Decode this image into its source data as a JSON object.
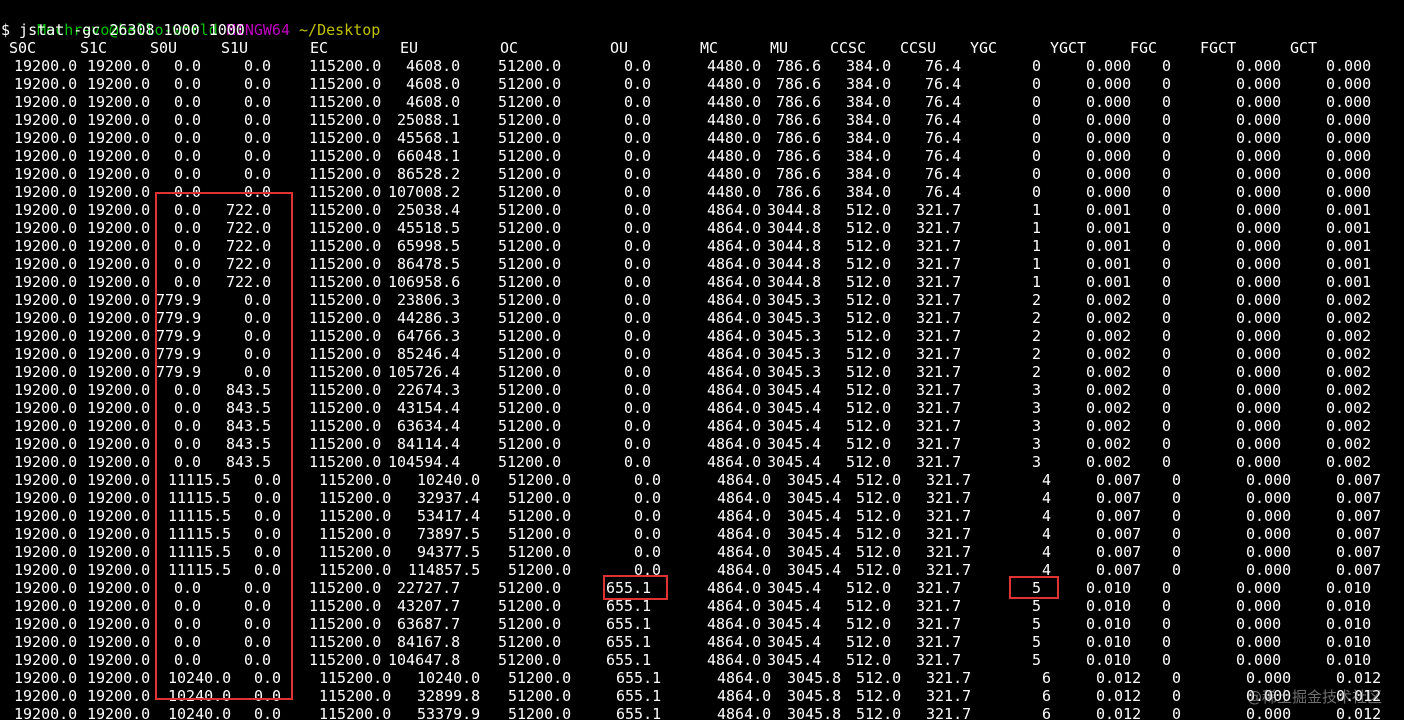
{
  "prompt": {
    "user_host": "Mechrevo@hello-world",
    "shell": "MINGW64",
    "cwd": "~/Desktop"
  },
  "command": "$ jstat -gc 26308 1000 1000",
  "columns": [
    "S0C",
    "S1C",
    "S0U",
    "S1U",
    "EC",
    "EU",
    "OC",
    "OU",
    "MC",
    "MU",
    "CCSC",
    "CCSU",
    "YGC",
    "YGCT",
    "FGC",
    "FGCT",
    "GCT"
  ],
  "rows": [
    [
      "19200.0",
      "19200.0",
      "0.0",
      "0.0",
      "115200.0",
      "4608.0",
      "51200.0",
      "0.0",
      "4480.0",
      "786.6",
      "384.0",
      "76.4",
      "0",
      "0.000",
      "0",
      "0.000",
      "0.000"
    ],
    [
      "19200.0",
      "19200.0",
      "0.0",
      "0.0",
      "115200.0",
      "4608.0",
      "51200.0",
      "0.0",
      "4480.0",
      "786.6",
      "384.0",
      "76.4",
      "0",
      "0.000",
      "0",
      "0.000",
      "0.000"
    ],
    [
      "19200.0",
      "19200.0",
      "0.0",
      "0.0",
      "115200.0",
      "4608.0",
      "51200.0",
      "0.0",
      "4480.0",
      "786.6",
      "384.0",
      "76.4",
      "0",
      "0.000",
      "0",
      "0.000",
      "0.000"
    ],
    [
      "19200.0",
      "19200.0",
      "0.0",
      "0.0",
      "115200.0",
      "25088.1",
      "51200.0",
      "0.0",
      "4480.0",
      "786.6",
      "384.0",
      "76.4",
      "0",
      "0.000",
      "0",
      "0.000",
      "0.000"
    ],
    [
      "19200.0",
      "19200.0",
      "0.0",
      "0.0",
      "115200.0",
      "45568.1",
      "51200.0",
      "0.0",
      "4480.0",
      "786.6",
      "384.0",
      "76.4",
      "0",
      "0.000",
      "0",
      "0.000",
      "0.000"
    ],
    [
      "19200.0",
      "19200.0",
      "0.0",
      "0.0",
      "115200.0",
      "66048.1",
      "51200.0",
      "0.0",
      "4480.0",
      "786.6",
      "384.0",
      "76.4",
      "0",
      "0.000",
      "0",
      "0.000",
      "0.000"
    ],
    [
      "19200.0",
      "19200.0",
      "0.0",
      "0.0",
      "115200.0",
      "86528.2",
      "51200.0",
      "0.0",
      "4480.0",
      "786.6",
      "384.0",
      "76.4",
      "0",
      "0.000",
      "0",
      "0.000",
      "0.000"
    ],
    [
      "19200.0",
      "19200.0",
      "0.0",
      "0.0",
      "115200.0",
      "107008.2",
      "51200.0",
      "0.0",
      "4480.0",
      "786.6",
      "384.0",
      "76.4",
      "0",
      "0.000",
      "0",
      "0.000",
      "0.000"
    ],
    [
      "19200.0",
      "19200.0",
      "0.0",
      "722.0",
      "115200.0",
      "25038.4",
      "51200.0",
      "0.0",
      "4864.0",
      "3044.8",
      "512.0",
      "321.7",
      "1",
      "0.001",
      "0",
      "0.000",
      "0.001"
    ],
    [
      "19200.0",
      "19200.0",
      "0.0",
      "722.0",
      "115200.0",
      "45518.5",
      "51200.0",
      "0.0",
      "4864.0",
      "3044.8",
      "512.0",
      "321.7",
      "1",
      "0.001",
      "0",
      "0.000",
      "0.001"
    ],
    [
      "19200.0",
      "19200.0",
      "0.0",
      "722.0",
      "115200.0",
      "65998.5",
      "51200.0",
      "0.0",
      "4864.0",
      "3044.8",
      "512.0",
      "321.7",
      "1",
      "0.001",
      "0",
      "0.000",
      "0.001"
    ],
    [
      "19200.0",
      "19200.0",
      "0.0",
      "722.0",
      "115200.0",
      "86478.5",
      "51200.0",
      "0.0",
      "4864.0",
      "3044.8",
      "512.0",
      "321.7",
      "1",
      "0.001",
      "0",
      "0.000",
      "0.001"
    ],
    [
      "19200.0",
      "19200.0",
      "0.0",
      "722.0",
      "115200.0",
      "106958.6",
      "51200.0",
      "0.0",
      "4864.0",
      "3044.8",
      "512.0",
      "321.7",
      "1",
      "0.001",
      "0",
      "0.000",
      "0.001"
    ],
    [
      "19200.0",
      "19200.0",
      "779.9",
      "0.0",
      "115200.0",
      "23806.3",
      "51200.0",
      "0.0",
      "4864.0",
      "3045.3",
      "512.0",
      "321.7",
      "2",
      "0.002",
      "0",
      "0.000",
      "0.002"
    ],
    [
      "19200.0",
      "19200.0",
      "779.9",
      "0.0",
      "115200.0",
      "44286.3",
      "51200.0",
      "0.0",
      "4864.0",
      "3045.3",
      "512.0",
      "321.7",
      "2",
      "0.002",
      "0",
      "0.000",
      "0.002"
    ],
    [
      "19200.0",
      "19200.0",
      "779.9",
      "0.0",
      "115200.0",
      "64766.3",
      "51200.0",
      "0.0",
      "4864.0",
      "3045.3",
      "512.0",
      "321.7",
      "2",
      "0.002",
      "0",
      "0.000",
      "0.002"
    ],
    [
      "19200.0",
      "19200.0",
      "779.9",
      "0.0",
      "115200.0",
      "85246.4",
      "51200.0",
      "0.0",
      "4864.0",
      "3045.3",
      "512.0",
      "321.7",
      "2",
      "0.002",
      "0",
      "0.000",
      "0.002"
    ],
    [
      "19200.0",
      "19200.0",
      "779.9",
      "0.0",
      "115200.0",
      "105726.4",
      "51200.0",
      "0.0",
      "4864.0",
      "3045.3",
      "512.0",
      "321.7",
      "2",
      "0.002",
      "0",
      "0.000",
      "0.002"
    ],
    [
      "19200.0",
      "19200.0",
      "0.0",
      "843.5",
      "115200.0",
      "22674.3",
      "51200.0",
      "0.0",
      "4864.0",
      "3045.4",
      "512.0",
      "321.7",
      "3",
      "0.002",
      "0",
      "0.000",
      "0.002"
    ],
    [
      "19200.0",
      "19200.0",
      "0.0",
      "843.5",
      "115200.0",
      "43154.4",
      "51200.0",
      "0.0",
      "4864.0",
      "3045.4",
      "512.0",
      "321.7",
      "3",
      "0.002",
      "0",
      "0.000",
      "0.002"
    ],
    [
      "19200.0",
      "19200.0",
      "0.0",
      "843.5",
      "115200.0",
      "63634.4",
      "51200.0",
      "0.0",
      "4864.0",
      "3045.4",
      "512.0",
      "321.7",
      "3",
      "0.002",
      "0",
      "0.000",
      "0.002"
    ],
    [
      "19200.0",
      "19200.0",
      "0.0",
      "843.5",
      "115200.0",
      "84114.4",
      "51200.0",
      "0.0",
      "4864.0",
      "3045.4",
      "512.0",
      "321.7",
      "3",
      "0.002",
      "0",
      "0.000",
      "0.002"
    ],
    [
      "19200.0",
      "19200.0",
      "0.0",
      "843.5",
      "115200.0",
      "104594.4",
      "51200.0",
      "0.0",
      "4864.0",
      "3045.4",
      "512.0",
      "321.7",
      "3",
      "0.002",
      "0",
      "0.000",
      "0.002"
    ],
    [
      "19200.0",
      "19200.0",
      "11115.5",
      "0.0",
      "115200.0",
      "10240.0",
      "51200.0",
      "0.0",
      "4864.0",
      "3045.4",
      "512.0",
      "321.7",
      "4",
      "0.007",
      "0",
      "0.000",
      "0.007"
    ],
    [
      "19200.0",
      "19200.0",
      "11115.5",
      "0.0",
      "115200.0",
      "32937.4",
      "51200.0",
      "0.0",
      "4864.0",
      "3045.4",
      "512.0",
      "321.7",
      "4",
      "0.007",
      "0",
      "0.000",
      "0.007"
    ],
    [
      "19200.0",
      "19200.0",
      "11115.5",
      "0.0",
      "115200.0",
      "53417.4",
      "51200.0",
      "0.0",
      "4864.0",
      "3045.4",
      "512.0",
      "321.7",
      "4",
      "0.007",
      "0",
      "0.000",
      "0.007"
    ],
    [
      "19200.0",
      "19200.0",
      "11115.5",
      "0.0",
      "115200.0",
      "73897.5",
      "51200.0",
      "0.0",
      "4864.0",
      "3045.4",
      "512.0",
      "321.7",
      "4",
      "0.007",
      "0",
      "0.000",
      "0.007"
    ],
    [
      "19200.0",
      "19200.0",
      "11115.5",
      "0.0",
      "115200.0",
      "94377.5",
      "51200.0",
      "0.0",
      "4864.0",
      "3045.4",
      "512.0",
      "321.7",
      "4",
      "0.007",
      "0",
      "0.000",
      "0.007"
    ],
    [
      "19200.0",
      "19200.0",
      "11115.5",
      "0.0",
      "115200.0",
      "114857.5",
      "51200.0",
      "0.0",
      "4864.0",
      "3045.4",
      "512.0",
      "321.7",
      "4",
      "0.007",
      "0",
      "0.000",
      "0.007"
    ],
    [
      "19200.0",
      "19200.0",
      "0.0",
      "0.0",
      "115200.0",
      "22727.7",
      "51200.0",
      "655.1",
      "4864.0",
      "3045.4",
      "512.0",
      "321.7",
      "5",
      "0.010",
      "0",
      "0.000",
      "0.010"
    ],
    [
      "19200.0",
      "19200.0",
      "0.0",
      "0.0",
      "115200.0",
      "43207.7",
      "51200.0",
      "655.1",
      "4864.0",
      "3045.4",
      "512.0",
      "321.7",
      "5",
      "0.010",
      "0",
      "0.000",
      "0.010"
    ],
    [
      "19200.0",
      "19200.0",
      "0.0",
      "0.0",
      "115200.0",
      "63687.7",
      "51200.0",
      "655.1",
      "4864.0",
      "3045.4",
      "512.0",
      "321.7",
      "5",
      "0.010",
      "0",
      "0.000",
      "0.010"
    ],
    [
      "19200.0",
      "19200.0",
      "0.0",
      "0.0",
      "115200.0",
      "84167.8",
      "51200.0",
      "655.1",
      "4864.0",
      "3045.4",
      "512.0",
      "321.7",
      "5",
      "0.010",
      "0",
      "0.000",
      "0.010"
    ],
    [
      "19200.0",
      "19200.0",
      "0.0",
      "0.0",
      "115200.0",
      "104647.8",
      "51200.0",
      "655.1",
      "4864.0",
      "3045.4",
      "512.0",
      "321.7",
      "5",
      "0.010",
      "0",
      "0.000",
      "0.010"
    ],
    [
      "19200.0",
      "19200.0",
      "10240.0",
      "0.0",
      "115200.0",
      "10240.0",
      "51200.0",
      "655.1",
      "4864.0",
      "3045.8",
      "512.0",
      "321.7",
      "6",
      "0.012",
      "0",
      "0.000",
      "0.012"
    ],
    [
      "19200.0",
      "19200.0",
      "10240.0",
      "0.0",
      "115200.0",
      "32899.8",
      "51200.0",
      "655.1",
      "4864.0",
      "3045.8",
      "512.0",
      "321.7",
      "6",
      "0.012",
      "0",
      "0.000",
      "0.012"
    ],
    [
      "19200.0",
      "19200.0",
      "10240.0",
      "0.0",
      "115200.0",
      "53379.9",
      "51200.0",
      "655.1",
      "4864.0",
      "3045.8",
      "512.0",
      "321.7",
      "6",
      "0.012",
      "0",
      "0.000",
      "0.012"
    ]
  ],
  "watermark": "@稀土掘金技术社区",
  "colors": {
    "background": "#000000",
    "text": "#ffffff",
    "user_host": "#00c000",
    "shell": "#c000c0",
    "cwd": "#c0c000",
    "highlight": "#e03232"
  }
}
